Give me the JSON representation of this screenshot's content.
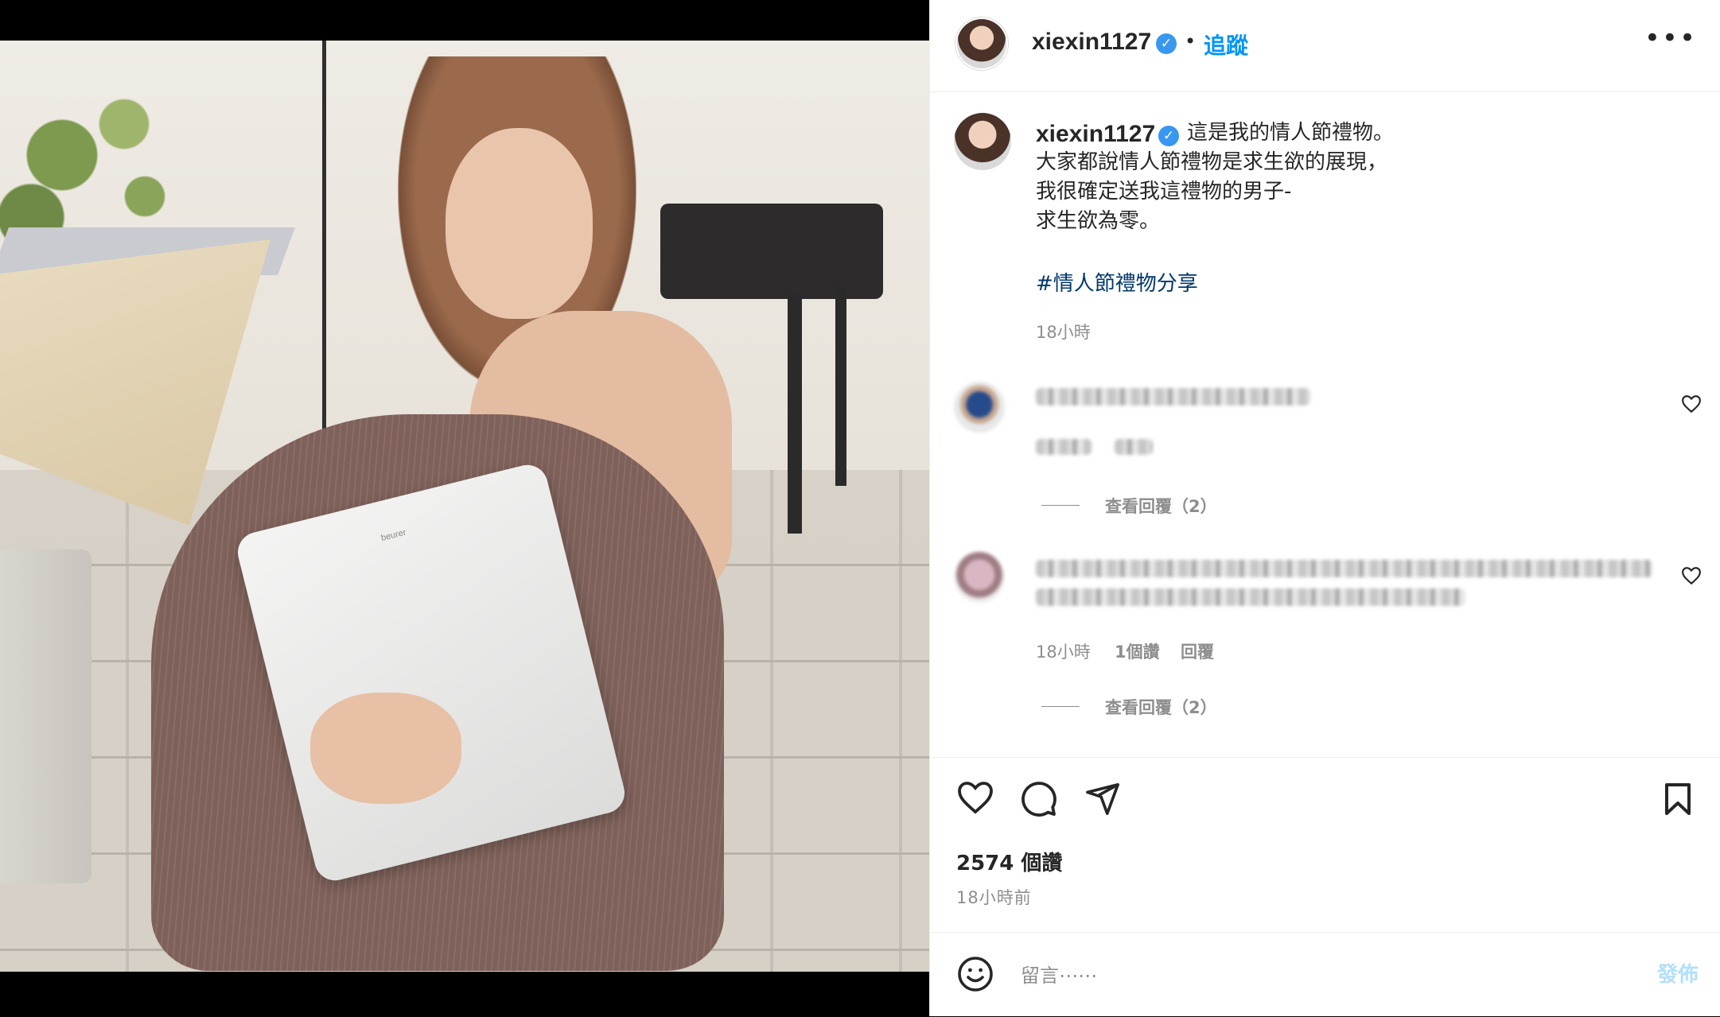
{
  "post": {
    "author": "xiexin1127",
    "follow_label": "追蹤",
    "separator": "•",
    "more_label": "•••",
    "verified_mark": "✓",
    "image_brand_text": "beurer",
    "caption": "這是我的情人節禮物。\n大家都說情人節禮物是求生欲的展現，\n我很確定送我這禮物的男子-\n求生欲為零。",
    "hashtag": "#情人節禮物分享",
    "caption_time": "18小時"
  },
  "comments": [
    {
      "time": "",
      "likes": "",
      "reply_label": "",
      "view_replies": "查看回覆（2）"
    },
    {
      "time": "18小時",
      "likes": "1個讚",
      "reply_label": "回覆",
      "view_replies": "查看回覆（2）"
    }
  ],
  "actions": {
    "like_icon": "heart-icon",
    "comment_icon": "comment-icon",
    "share_icon": "paper-plane-icon",
    "save_icon": "bookmark-icon",
    "likes_count": "2574 個讚",
    "posted_ago": "18小時前"
  },
  "composer": {
    "emoji_icon": "smiley-icon",
    "placeholder": "留言⋯⋯",
    "post_label": "發佈"
  },
  "colors": {
    "accent": "#0095f6",
    "verified": "#3897f0",
    "hashtag": "#00376b",
    "muted": "#8e8e8e",
    "post_disabled": "#b2dffc"
  }
}
